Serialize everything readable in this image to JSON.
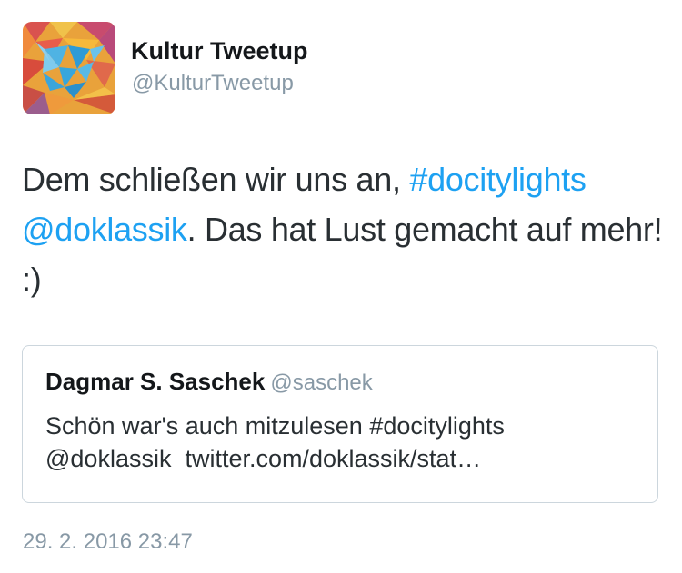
{
  "author": {
    "display_name": "Kultur Tweetup",
    "handle": "@KulturTweetup",
    "avatar_icon": "bird-mosaic-icon"
  },
  "tweet": {
    "text_part1": "Dem schließen wir uns an, ",
    "hashtag": "#docitylights",
    "mention": "@doklassik",
    "text_part2": ". Das hat Lust gemacht auf mehr! :)"
  },
  "quoted_tweet": {
    "display_name": "Dagmar S. Saschek",
    "handle": "@saschek",
    "line1": "Schön war's auch mitzulesen #docitylights",
    "line2_mention": "@doklassik",
    "line2_link": "twitter.com/doklassik/stat…"
  },
  "timestamp": "29. 2. 2016 23:47",
  "colors": {
    "link": "#1da1f2",
    "secondary_text": "#8899a6",
    "border": "#ccd6dd"
  }
}
